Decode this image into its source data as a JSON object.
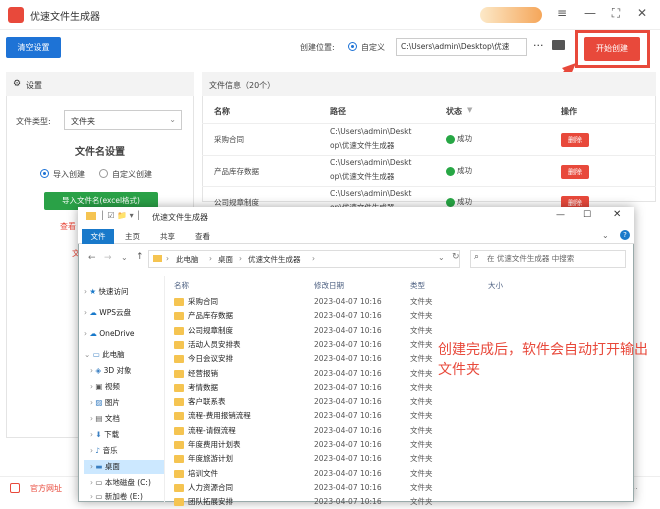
{
  "app": {
    "title": "优速文件生成器"
  },
  "toolbar": {
    "clear_label": "清空设置",
    "location_label": "创建位置:",
    "custom_label": "自定义",
    "path": "C:\\Users\\admin\\Desktop\\优速",
    "start_label": "开始创建"
  },
  "settings": {
    "header": "设置",
    "type_label": "文件类型:",
    "type_value": "文件夹",
    "name_header": "文件名设置",
    "import_label": "导入创建",
    "custom_label": "自定义创建",
    "import_btn": "导入文件名(excel格式)",
    "partial1": "查看",
    "partial2": "文"
  },
  "fileinfo": {
    "header": "文件信息（20个）",
    "col_name": "名称",
    "col_path": "路径",
    "col_status": "状态",
    "col_op": "操作",
    "rows": [
      {
        "name": "采购合同",
        "path1": "C:\\Users\\admin\\Deskt",
        "path2": "op\\优速文件生成器",
        "status": "成功",
        "op": "删除"
      },
      {
        "name": "产品库存数据",
        "path1": "C:\\Users\\admin\\Deskt",
        "path2": "op\\优速文件生成器",
        "status": "成功",
        "op": "删除"
      },
      {
        "name": "公司规章制度",
        "path1": "C:\\Users\\admin\\Deskt",
        "path2": "op\\优速文件生成器",
        "status": "成功",
        "op": "删除"
      }
    ]
  },
  "bottom": {
    "website": "官方网址"
  },
  "explorer": {
    "title": "优速文件生成器",
    "tabs": [
      "文件",
      "主页",
      "共享",
      "查看"
    ],
    "address": [
      "此电脑",
      "桌面",
      "优速文件生成器"
    ],
    "search_placeholder": "在 优速文件生成器 中搜索",
    "col_name": "名称",
    "col_date": "修改日期",
    "col_type": "类型",
    "col_size": "大小",
    "nav": [
      "快速访问",
      "WPS云盘",
      "OneDrive",
      "此电脑",
      "3D 对象",
      "视频",
      "图片",
      "文档",
      "下载",
      "音乐",
      "桌面",
      "本地磁盘 (C:)",
      "新加卷 (E:)"
    ],
    "files": [
      {
        "name": "采购合同",
        "date": "2023-04-07 10:16",
        "type": "文件夹"
      },
      {
        "name": "产品库存数据",
        "date": "2023-04-07 10:16",
        "type": "文件夹"
      },
      {
        "name": "公司规章制度",
        "date": "2023-04-07 10:16",
        "type": "文件夹"
      },
      {
        "name": "活动人员安排表",
        "date": "2023-04-07 10:16",
        "type": "文件夹"
      },
      {
        "name": "今日会议安排",
        "date": "2023-04-07 10:16",
        "type": "文件夹"
      },
      {
        "name": "经营报销",
        "date": "2023-04-07 10:16",
        "type": "文件夹"
      },
      {
        "name": "考情数据",
        "date": "2023-04-07 10:16",
        "type": "文件夹"
      },
      {
        "name": "客户联系表",
        "date": "2023-04-07 10:16",
        "type": "文件夹"
      },
      {
        "name": "流程-费用报销流程",
        "date": "2023-04-07 10:16",
        "type": "文件夹"
      },
      {
        "name": "流程-请假流程",
        "date": "2023-04-07 10:16",
        "type": "文件夹"
      },
      {
        "name": "年度费用计划表",
        "date": "2023-04-07 10:16",
        "type": "文件夹"
      },
      {
        "name": "年度旅游计划",
        "date": "2023-04-07 10:16",
        "type": "文件夹"
      },
      {
        "name": "培训文件",
        "date": "2023-04-07 10:16",
        "type": "文件夹"
      },
      {
        "name": "人力资源合同",
        "date": "2023-04-07 10:16",
        "type": "文件夹"
      },
      {
        "name": "团队拓展安排",
        "date": "2023-04-07 10:16",
        "type": "文件夹"
      }
    ]
  },
  "annotation": "创建完成后，软件会自动打开输出文件夹"
}
